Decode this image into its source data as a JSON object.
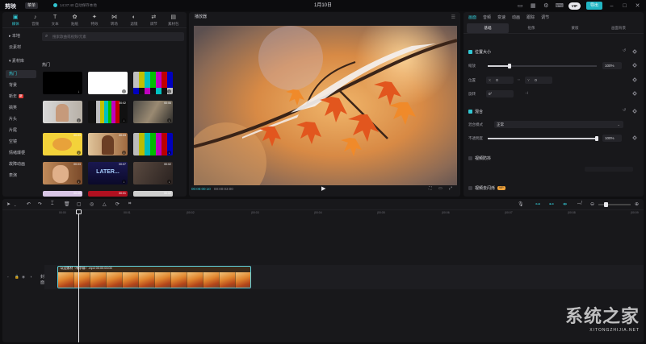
{
  "app": {
    "logo": "剪映",
    "menu_label": "菜单",
    "autosave": "14:37:40 自动保存本地",
    "project_title": "1月10日",
    "vip_label": "VIP",
    "export_label": "导出"
  },
  "media": {
    "tools": [
      {
        "label": "媒体",
        "icon": "▣"
      },
      {
        "label": "音频",
        "icon": "♪"
      },
      {
        "label": "文本",
        "icon": "T"
      },
      {
        "label": "贴纸",
        "icon": "✿"
      },
      {
        "label": "特效",
        "icon": "✦"
      },
      {
        "label": "转场",
        "icon": "⋈"
      },
      {
        "label": "滤镜",
        "icon": "◐"
      },
      {
        "label": "调节",
        "icon": "⇄"
      },
      {
        "label": "素材包",
        "icon": "▤"
      }
    ],
    "side": {
      "local": "▸ 本地",
      "cloud": "云素材",
      "library": "▾ 素材库",
      "items": [
        "热门",
        "背景",
        "新年",
        "搞笑",
        "片头",
        "片尾",
        "空镜",
        "情绪爆梗",
        "故障动画",
        "表演"
      ],
      "new_tag": "新"
    },
    "search_placeholder": "搜索歌曲或视频/元素",
    "hot_title": "热门",
    "thumbs": [
      {
        "dur": ""
      },
      {
        "dur": ""
      },
      {
        "dur": ""
      },
      {
        "dur": ""
      },
      {
        "dur": "00:02"
      },
      {
        "dur": "00:06"
      },
      {
        "dur": "00:03"
      },
      {
        "dur": "00:03"
      },
      {
        "dur": ""
      },
      {
        "dur": "00:03"
      },
      {
        "dur": "00:07"
      },
      {
        "dur": "00:02"
      },
      {
        "dur": "00:05"
      },
      {
        "dur": "00:01"
      },
      {
        "dur": "00:02"
      }
    ],
    "thumb_texts": {
      "later": "LATER...",
      "f": "F..."
    }
  },
  "player": {
    "title": "播放器",
    "tc_current": "00:00:00:10",
    "tc_total": "00:00:03:00"
  },
  "props": {
    "tabs": [
      "画面",
      "音频",
      "变速",
      "动画",
      "跟踪",
      "调节"
    ],
    "subtabs": [
      "基础",
      "抠像",
      "蒙版",
      "画面背景"
    ],
    "pos_size_title": "位置大小",
    "scale_label": "缩放",
    "scale_value": "100%",
    "scale_level": 0.2,
    "position_label": "位置",
    "pos_x_label": "X",
    "pos_x": "0",
    "pos_y_label": "Y",
    "pos_y": "0",
    "rotate_label": "旋转",
    "rotate_value": "0°",
    "blend_title": "混合",
    "blend_mode_label": "混合模式",
    "blend_mode_value": "正常",
    "opacity_label": "不透明度",
    "opacity_value": "100%",
    "opacity_level": 1.0,
    "stabilize_title": "视频防抖",
    "denoise_title": "视频去闪烁",
    "denoise_badge": "VIP"
  },
  "timeline": {
    "ticks": [
      "00:00",
      "00:01",
      "|00:02",
      "|00:03",
      "|00:04",
      "|00:05",
      "|00:06",
      "|00:07",
      "|00:08",
      "|00:09"
    ],
    "track_label": "封面",
    "clip_name": "玩迎素材（有字幕）.mp4   00:00:03:00"
  },
  "watermark": {
    "logo": "系统之家",
    "url": "XITONGZHIJIA.NET"
  },
  "colors": {
    "accent": "#32c8d4",
    "export": "#22b6c4",
    "panel": "#18181b",
    "background": "#0f0f11"
  }
}
